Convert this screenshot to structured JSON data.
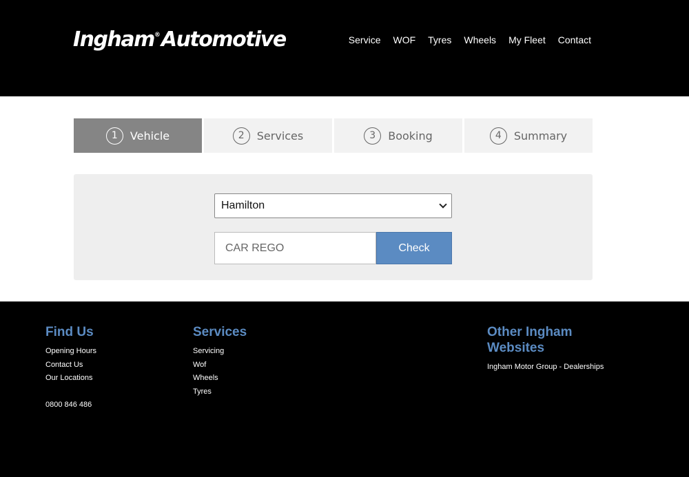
{
  "header": {
    "logo_main": "Ingham",
    "logo_mark": "®",
    "logo_sub": "Automotive",
    "nav": [
      "Service",
      "WOF",
      "Tyres",
      "Wheels",
      "My Fleet",
      "Contact"
    ]
  },
  "steps": [
    {
      "num": "1",
      "label": "Vehicle"
    },
    {
      "num": "2",
      "label": "Services"
    },
    {
      "num": "3",
      "label": "Booking"
    },
    {
      "num": "4",
      "label": "Summary"
    }
  ],
  "form": {
    "location_value": "Hamilton",
    "rego_placeholder": "CAR REGO",
    "check_label": "Check"
  },
  "footer": {
    "find_us": {
      "title": "Find Us",
      "links": [
        "Opening Hours",
        "Contact Us",
        "Our Locations"
      ],
      "phone": "0800 846 486"
    },
    "services": {
      "title": "Services",
      "links": [
        "Servicing",
        "Wof",
        "Wheels",
        "Tyres"
      ]
    },
    "other": {
      "title": "Other Ingham Websites",
      "links": [
        "Ingham Motor Group - Dealerships"
      ]
    }
  },
  "colors": {
    "accent": "#5b8bc2",
    "active_step": "#858585"
  }
}
